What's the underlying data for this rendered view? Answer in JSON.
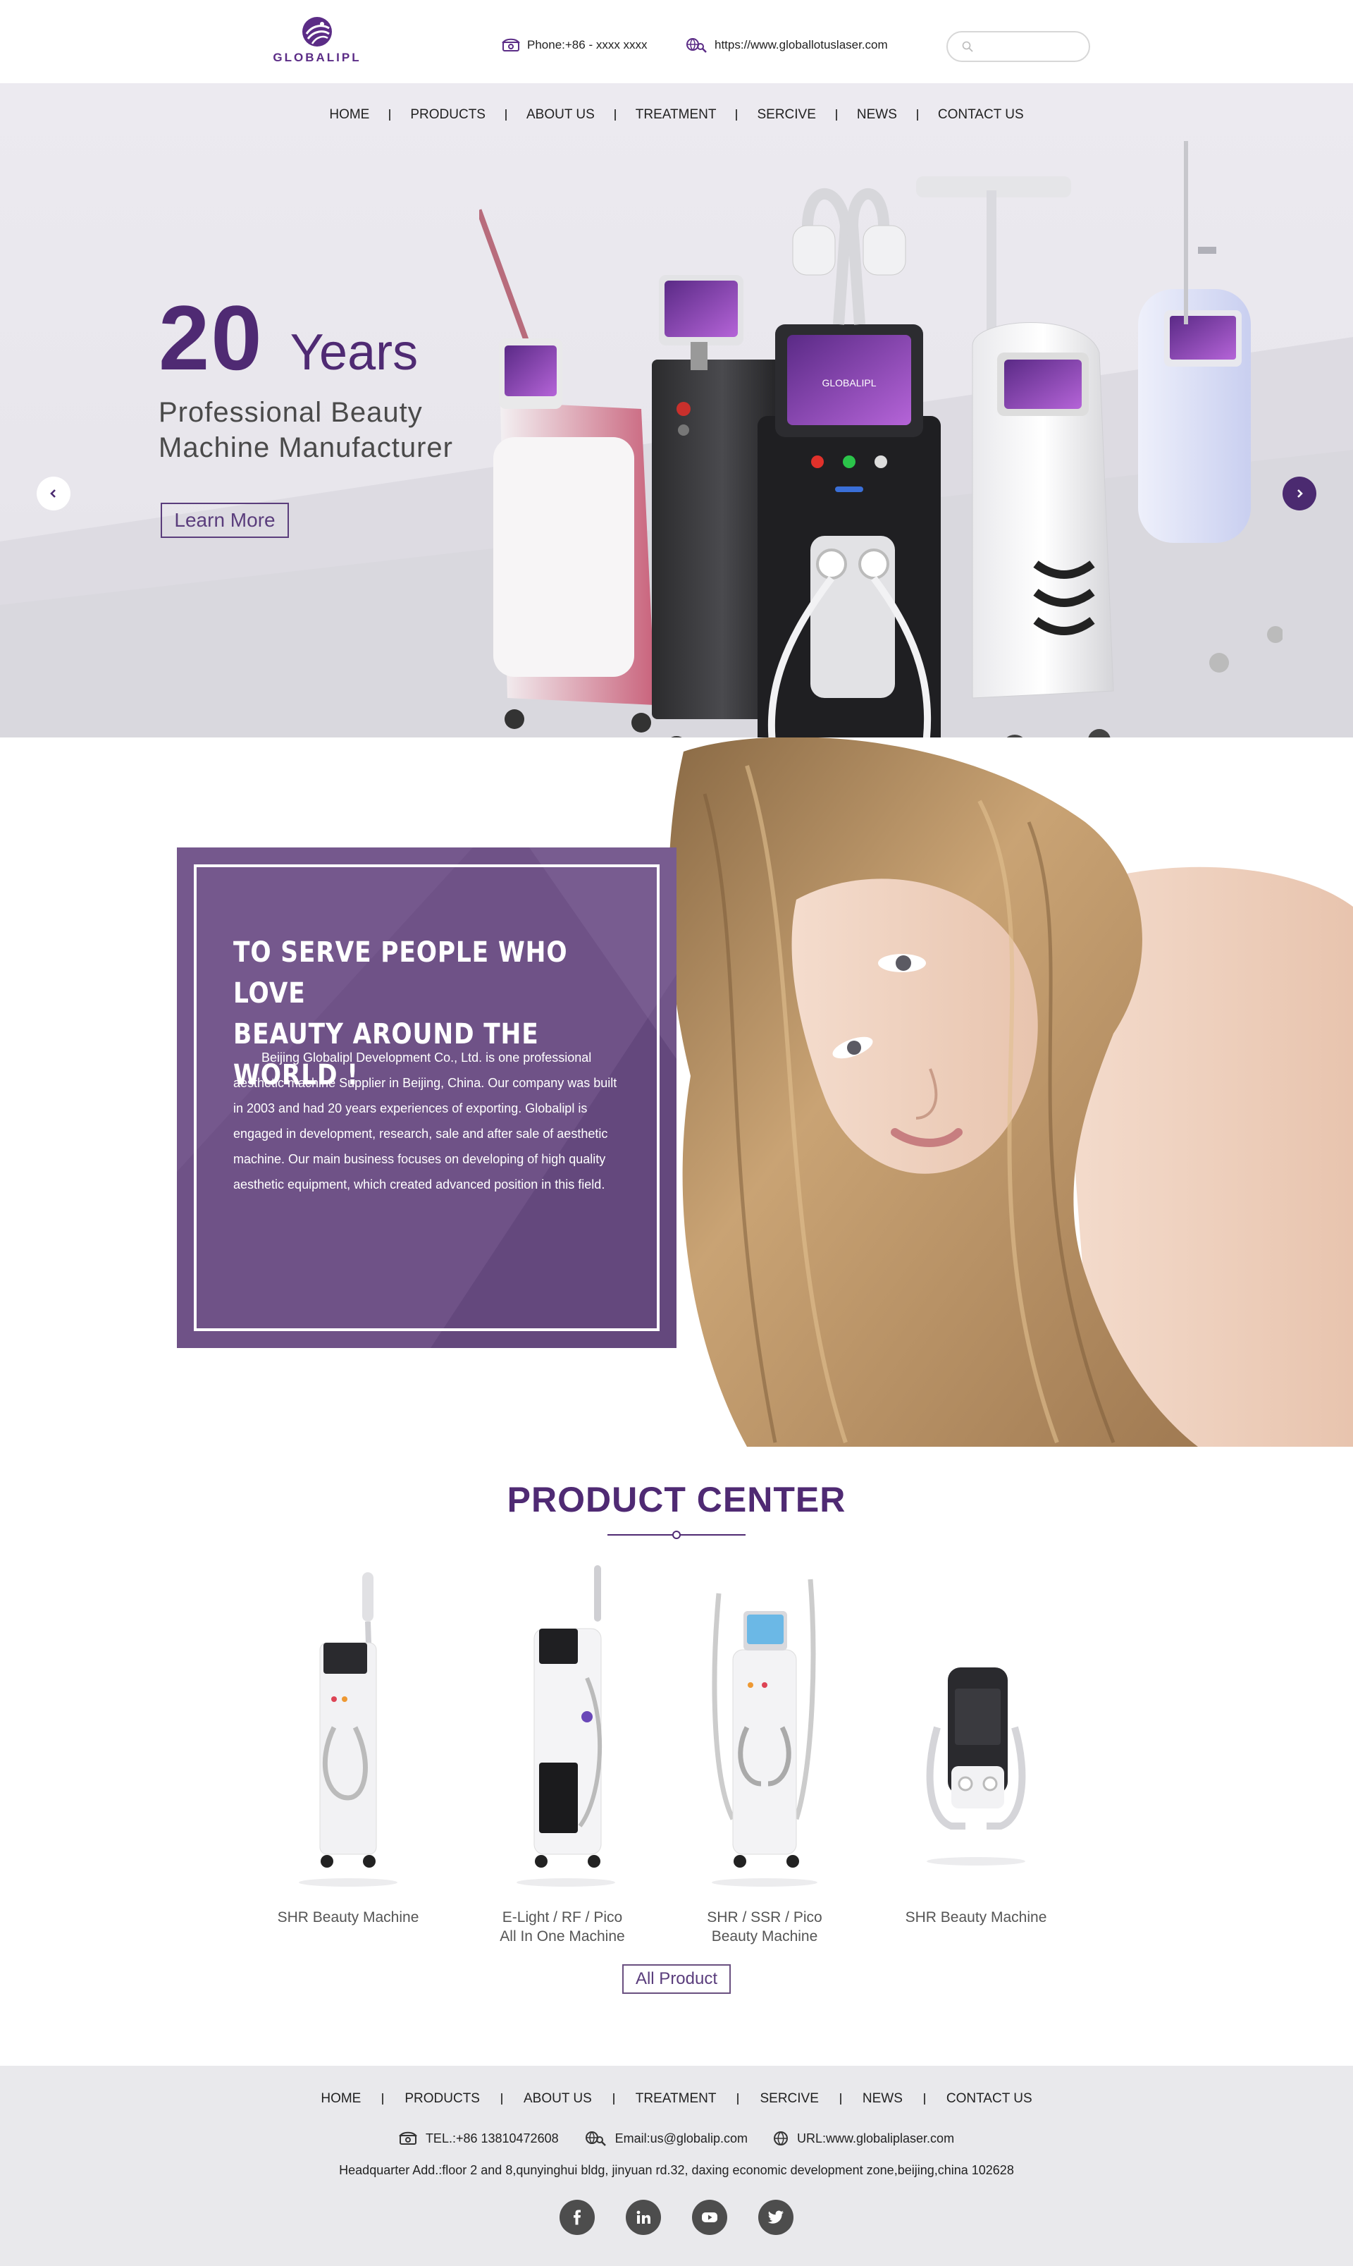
{
  "brand": {
    "logo_text": "GLOBALIPL",
    "accent": "#4f2a73",
    "accent_light": "#6f5287"
  },
  "header": {
    "phone": "Phone:+86 - xxxx xxxx",
    "url": "https://www.globallotuslaser.com",
    "search_placeholder": "",
    "icons": {
      "phone": "phone-icon",
      "url": "globe-search-icon",
      "search": "search-icon"
    }
  },
  "nav": {
    "items": [
      {
        "label": "HOME"
      },
      {
        "label": "PRODUCTS"
      },
      {
        "label": "ABOUT US"
      },
      {
        "label": "TREATMENT"
      },
      {
        "label": "SERCIVE"
      },
      {
        "label": "NEWS"
      },
      {
        "label": "CONTACT US"
      }
    ]
  },
  "hero": {
    "number": "20",
    "word": "Years",
    "subtitle_line1": "Professional Beauty",
    "subtitle_line2": "Machine Manufacturer",
    "button": "Learn More",
    "screen_brand": "GLOBALIPL"
  },
  "about": {
    "title_line1": "TO SERVE PEOPLE WHO LOVE",
    "title_line2": "BEAUTY AROUND THE WORLD !",
    "text": "Beijing Globalipl Development Co., Ltd. is one professional aesthetic machine Supplier in Beijing, China. Our company was built in 2003 and had 20 years experiences of exporting. Globalipl is engaged in development, research, sale and after sale of aesthetic machine. Our main business focuses on developing of high quality aesthetic equipment, which created advanced position in this field."
  },
  "product_center": {
    "title": "PRODUCT CENTER",
    "products": [
      {
        "line1": "SHR Beauty Machine",
        "line2": ""
      },
      {
        "line1": "E-Light / RF / Pico",
        "line2": "All In One Machine"
      },
      {
        "line1": "SHR / SSR / Pico",
        "line2": "Beauty Machine"
      },
      {
        "line1": "SHR Beauty Machine",
        "line2": ""
      }
    ],
    "all_button": "All Product"
  },
  "footer": {
    "nav": [
      {
        "label": "HOME"
      },
      {
        "label": "PRODUCTS"
      },
      {
        "label": "ABOUT US"
      },
      {
        "label": "TREATMENT"
      },
      {
        "label": "SERCIVE"
      },
      {
        "label": "NEWS"
      },
      {
        "label": "CONTACT US"
      }
    ],
    "tel": "TEL.:+86 13810472608",
    "email": "Email:us@globalip.com",
    "web": "URL:www.globaliplaser.com",
    "address": "Headquarter Add.:floor 2 and 8,qunyinghui bldg, jinyuan rd.32, daxing economic development zone,beijing,china 102628",
    "social": [
      "facebook-icon",
      "linkedin-icon",
      "youtube-icon",
      "twitter-icon"
    ]
  }
}
